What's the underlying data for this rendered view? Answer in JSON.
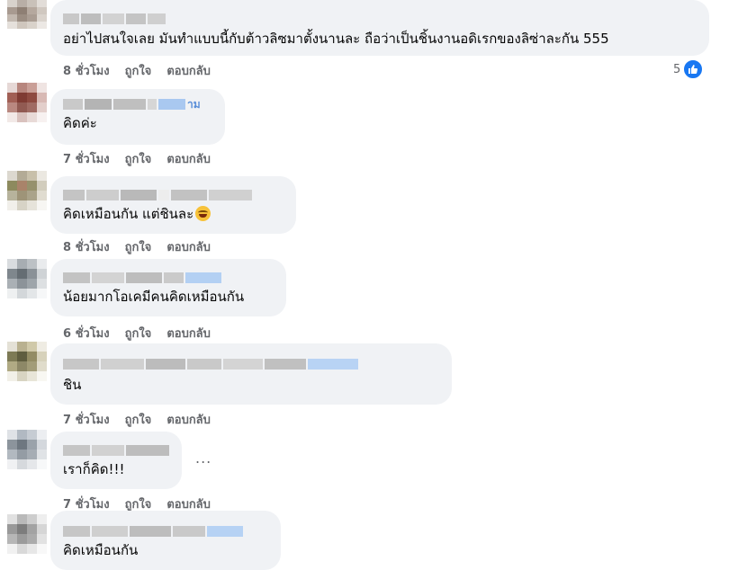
{
  "comments": [
    {
      "text": "อย่าไปสนใจเลย มันทำแบบนี้กับต้าวลิซมาตั้งนานละ ถือว่าเป็นชิ้นงานอดิเรกของลิซ่าละกัน 555",
      "time": "8 ชั่วโมง",
      "like_label": "ถูกใจ",
      "reply_label": "ตอบกลับ",
      "reaction_count": "5"
    },
    {
      "name_suffix": "าม",
      "text": "คิดค่ะ",
      "time": "7 ชั่วโมง",
      "like_label": "ถูกใจ",
      "reply_label": "ตอบกลับ"
    },
    {
      "text": "คิดเหมือนกัน แต่ชินละ",
      "time": "8 ชั่วโมง",
      "like_label": "ถูกใจ",
      "reply_label": "ตอบกลับ"
    },
    {
      "text": "น้อยมากโอเคมีคนคิดเหมือนกัน",
      "time": "6 ชั่วโมง",
      "like_label": "ถูกใจ",
      "reply_label": "ตอบกลับ"
    },
    {
      "text": "ชิน",
      "time": "7 ชั่วโมง",
      "like_label": "ถูกใจ",
      "reply_label": "ตอบกลับ"
    },
    {
      "text": "เราก็คิด!!!",
      "time": "7 ชั่วโมง",
      "like_label": "ถูกใจ",
      "reply_label": "ตอบกลับ",
      "more_label": "..."
    },
    {
      "text": "คิดเหมือนกัน"
    }
  ],
  "icons": {
    "like": "thumbs-up-icon",
    "emoji": "grinning-sweat-emoji-icon",
    "more": "more-options-icon"
  },
  "colors": {
    "bubble": "#f0f2f5",
    "meta": "#65676b",
    "like_blue": "#1877f2"
  }
}
